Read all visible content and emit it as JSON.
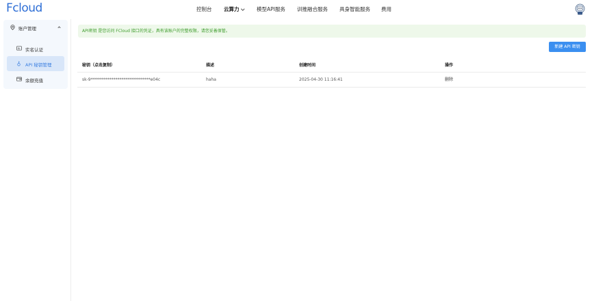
{
  "header": {
    "logo": "Fcloud",
    "nav": [
      {
        "label": "控制台"
      },
      {
        "label": "云算力"
      },
      {
        "label": "模型API服务"
      },
      {
        "label": "训推融合服务"
      },
      {
        "label": "具身智能服务"
      },
      {
        "label": "费用"
      }
    ]
  },
  "sidebar": {
    "group_label": "账户管理",
    "items": [
      {
        "label": "实名认证",
        "icon": "id-card-icon"
      },
      {
        "label": "API 秘钥管理",
        "icon": "key-icon"
      },
      {
        "label": "余额充值",
        "icon": "wallet-icon"
      }
    ]
  },
  "notice": "API密钥 是您访问 FCloud 接口的凭证，具有该账户的完整权限，请您妥善保管。",
  "new_button": "新建 API 密钥",
  "table": {
    "headers": [
      "秘钥（点击复制）",
      "描述",
      "创建时间",
      "操作"
    ],
    "rows": [
      {
        "key": "sk-9*****************************e04c",
        "desc": "haha",
        "created": "2025-04-30 11:16:41",
        "action": "删除"
      }
    ]
  },
  "colors": {
    "accent": "#3b8ff0",
    "active_bg": "#d8e6f9",
    "notice_bg": "#eef8ea",
    "notice_text": "#3f9d2d"
  }
}
